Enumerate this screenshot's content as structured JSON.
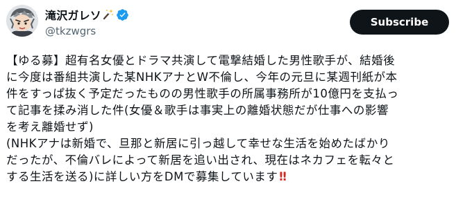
{
  "post": {
    "author": {
      "display_name": "滝沢ガレソ",
      "handle": "@tkzwgrs",
      "avatar_icon": "anime-character-avatar",
      "name_emoji_icon": "magic-wand-icon",
      "verified_icon": "verified-badge-icon",
      "verified_color": "#1d9bf0"
    },
    "subscribe_label": "Subscribe",
    "body_lines": [
      "【ゆる募】超有名女優とドラマ共演して電撃結婚した男性歌手が、結婚後",
      "に今度は番組共演した某NHKアナとW不倫し、今年の元旦に某週刊紙が本",
      "件をすっぱ抜く予定だったものの男性歌手の所属事務所が10億円を支払っ",
      "て記事を揉み消した件(女優＆歌手は事実上の離婚状態だが仕事への影響",
      "を考え離婚せず)",
      "(NHKアナは新婚で、旦那と新居に引っ越して幸せな生活を始めたばかり",
      "だったが、不倫バレによって新居を追い出され、現在はネカフェを転々と",
      "する生活を送る)に詳しい方をDMで募集しています"
    ],
    "body_end_emoji": "‼",
    "colors": {
      "text": "#0f1419",
      "secondary": "#536471",
      "button_bg": "#0f1419",
      "emoji": "#d7261e"
    }
  }
}
